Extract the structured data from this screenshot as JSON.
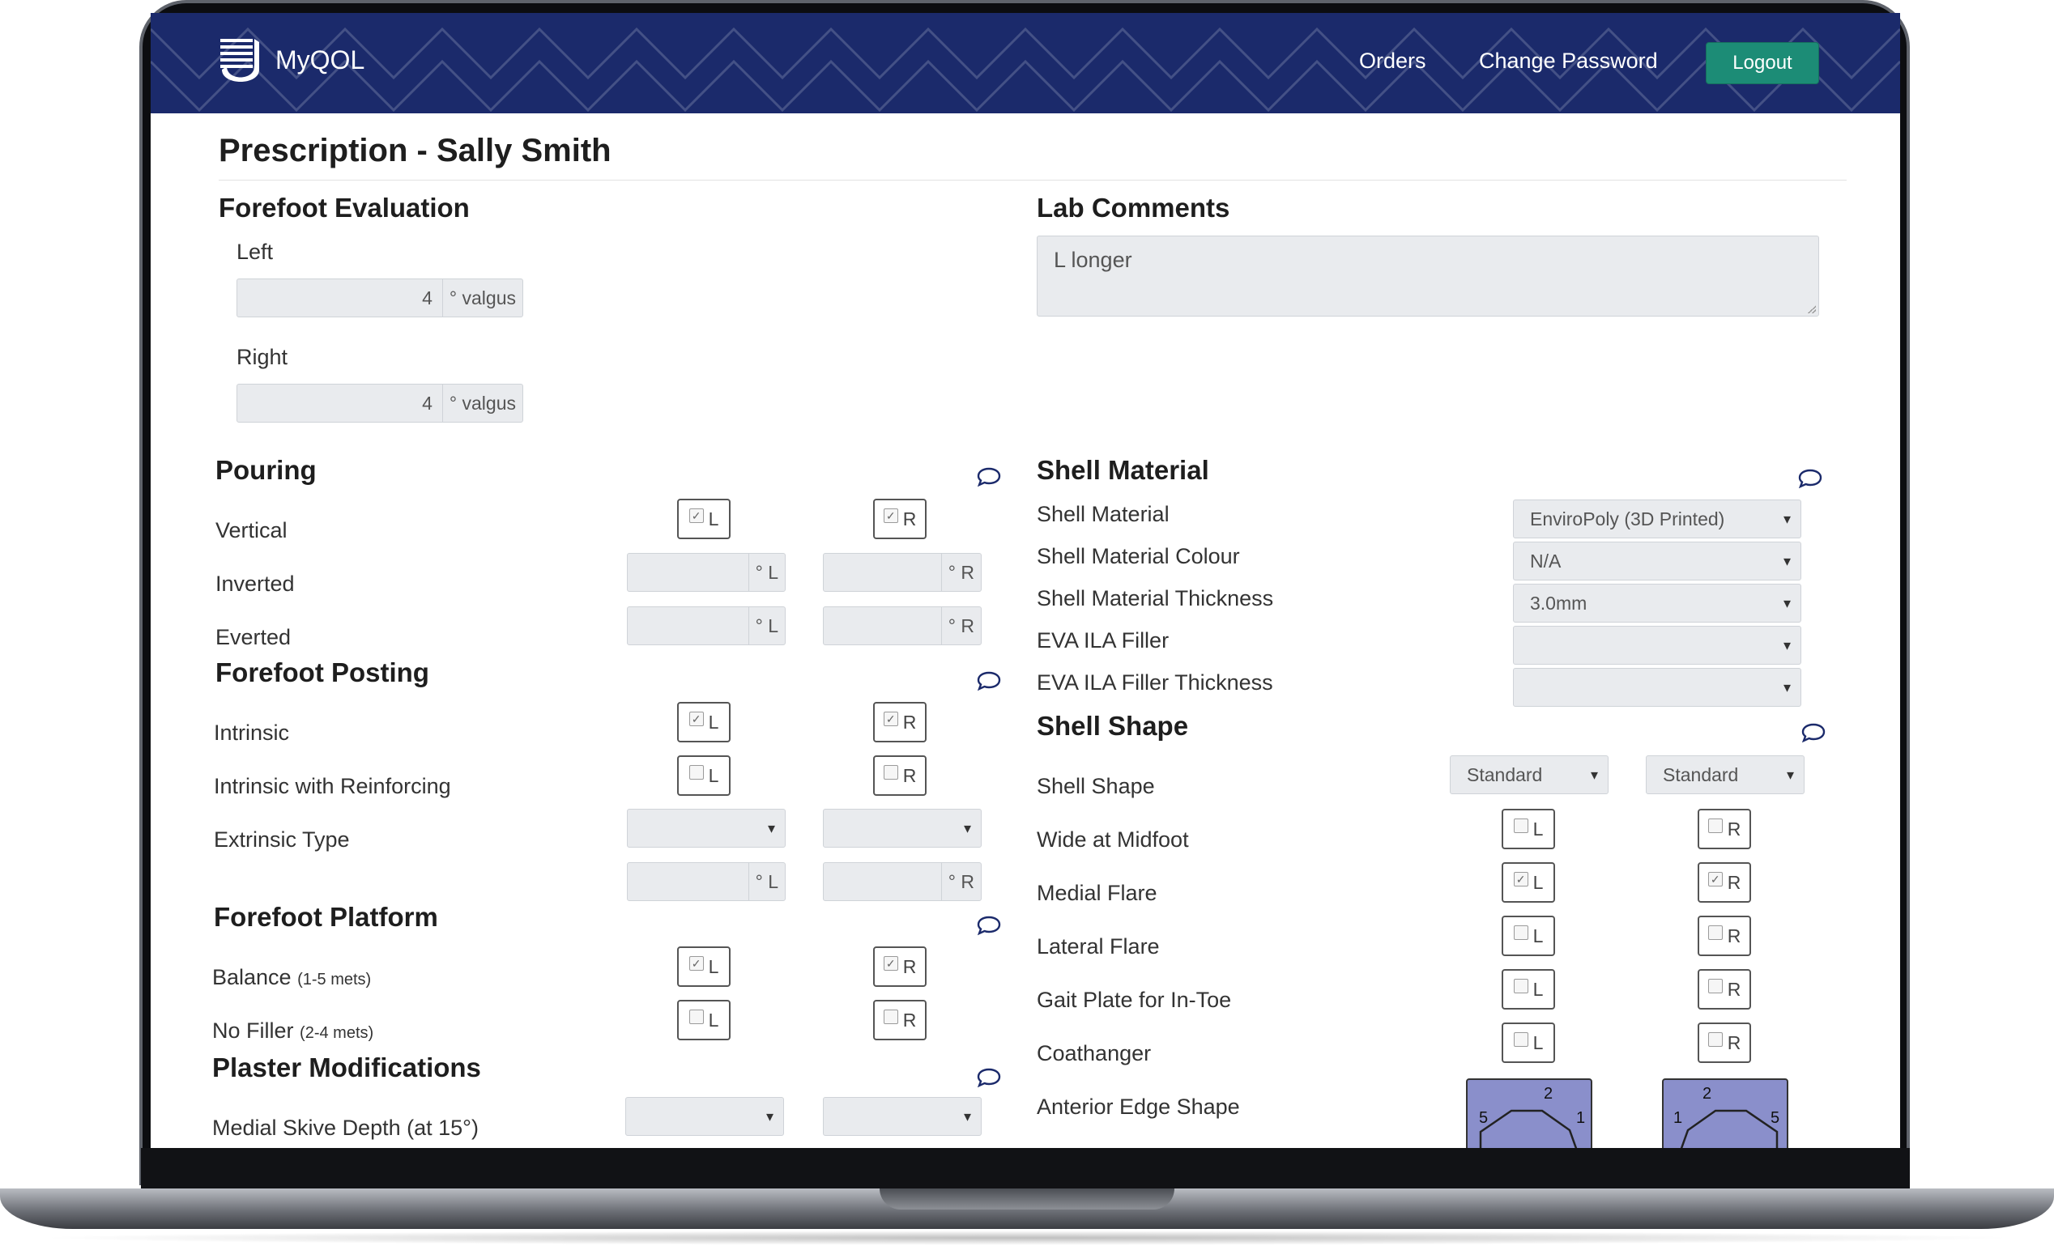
{
  "nav": {
    "brand": "MyQOL",
    "links": {
      "orders": "Orders",
      "change_password": "Change Password"
    },
    "logout": "Logout"
  },
  "page": {
    "title": "Prescription - Sally Smith"
  },
  "forefoot_evaluation": {
    "heading": "Forefoot Evaluation",
    "left_label": "Left",
    "left_value": "4",
    "right_label": "Right",
    "right_value": "4",
    "unit": "° valgus"
  },
  "lab_comments": {
    "heading": "Lab Comments",
    "text": "L longer"
  },
  "pouring": {
    "heading": "Pouring",
    "vertical": "Vertical",
    "inverted": "Inverted",
    "everted": "Everted"
  },
  "forefoot_posting": {
    "heading": "Forefoot Posting",
    "intrinsic": "Intrinsic",
    "intrinsic_reinforcing": "Intrinsic with Reinforcing",
    "extrinsic_type": "Extrinsic Type"
  },
  "forefoot_platform": {
    "heading": "Forefoot Platform",
    "balance": "Balance",
    "balance_note": "(1-5 mets)",
    "no_filler": "No Filler",
    "no_filler_note": "(2-4 mets)"
  },
  "plaster": {
    "heading": "Plaster Modifications",
    "medial_skive": "Medial Skive Depth (at 15°)"
  },
  "shell_material": {
    "heading": "Shell Material",
    "material_label": "Shell Material",
    "material_value": "EnviroPoly (3D Printed)",
    "colour_label": "Shell Material Colour",
    "colour_value": "N/A",
    "thickness_label": "Shell Material Thickness",
    "thickness_value": "3.0mm",
    "eva_label": "EVA ILA Filler",
    "eva_thickness_label": "EVA ILA Filler Thickness"
  },
  "shell_shape": {
    "heading": "Shell Shape",
    "shape_label": "Shell Shape",
    "shape_left": "Standard",
    "shape_right": "Standard",
    "wide_midfoot": "Wide at Midfoot",
    "medial_flare": "Medial Flare",
    "lateral_flare": "Lateral Flare",
    "gait_plate": "Gait Plate for In-Toe",
    "coathanger": "Coathanger",
    "anterior_edge": "Anterior Edge Shape",
    "edge_left_labels": [
      "5",
      "2",
      "1"
    ],
    "edge_right_labels": [
      "1",
      "2",
      "5"
    ]
  },
  "units": {
    "deg_l": "° L",
    "deg_r": "° R"
  },
  "side": {
    "L": "L",
    "R": "R"
  },
  "checks": {
    "vertical": [
      true,
      true
    ],
    "intrinsic": [
      true,
      true
    ],
    "intrinsic_reinforcing": [
      false,
      false
    ],
    "balance": [
      true,
      true
    ],
    "no_filler": [
      false,
      false
    ],
    "wide_midfoot": [
      false,
      false
    ],
    "medial_flare": [
      true,
      true
    ],
    "lateral_flare": [
      false,
      false
    ],
    "gait_plate": [
      false,
      false
    ],
    "coathanger": [
      false,
      false
    ]
  },
  "colors": {
    "navbar": "#1b2a6b",
    "logout": "#1c8c76",
    "edge_shape": "#8a8fcb",
    "chat_icon": "#1b2a6b"
  }
}
